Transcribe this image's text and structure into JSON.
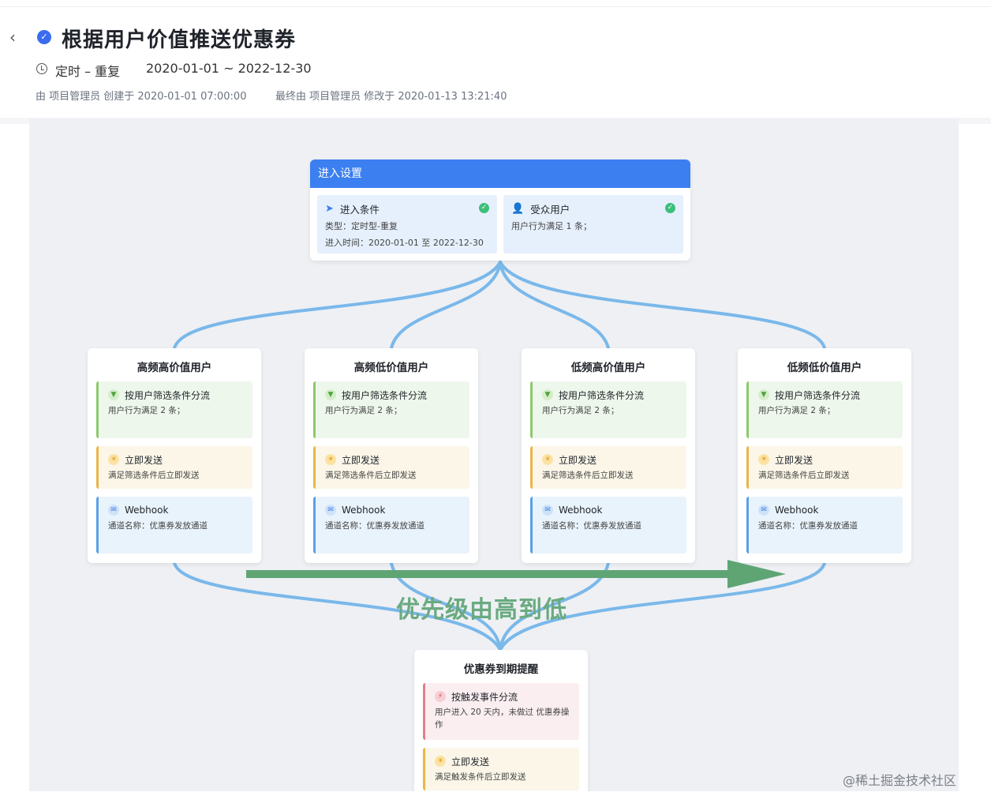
{
  "header": {
    "title": "根据用户价值推送优惠券",
    "schedule_type": "定时 – 重复",
    "schedule_range": "2020-01-01 ~ 2022-12-30",
    "created": "由 项目管理员 创建于 2020-01-01 07:00:00",
    "modified": "最终由 项目管理员 修改于 2020-01-13 13:21:40"
  },
  "entry": {
    "title": "进入设置",
    "condition": {
      "title": "进入条件",
      "type": "类型：定时型-重复",
      "time": "进入时间：2020-01-01 至 2022-12-30"
    },
    "audience": {
      "title": "受众用户",
      "desc": "用户行为满足 1 条；"
    }
  },
  "branches": [
    {
      "title": "高频高价值用户",
      "filter_title": "按用户筛选条件分流",
      "filter_desc": "用户行为满足 2 条；",
      "send_title": "立即发送",
      "send_desc": "满足筛选条件后立即发送",
      "hook_title": "Webhook",
      "hook_desc": "通道名称：优惠券发放通道"
    },
    {
      "title": "高频低价值用户",
      "filter_title": "按用户筛选条件分流",
      "filter_desc": "用户行为满足 2 条；",
      "send_title": "立即发送",
      "send_desc": "满足筛选条件后立即发送",
      "hook_title": "Webhook",
      "hook_desc": "通道名称：优惠券发放通道"
    },
    {
      "title": "低频高价值用户",
      "filter_title": "按用户筛选条件分流",
      "filter_desc": "用户行为满足 2 条；",
      "send_title": "立即发送",
      "send_desc": "满足筛选条件后立即发送",
      "hook_title": "Webhook",
      "hook_desc": "通道名称：优惠券发放通道"
    },
    {
      "title": "低频低价值用户",
      "filter_title": "按用户筛选条件分流",
      "filter_desc": "用户行为满足 2 条；",
      "send_title": "立即发送",
      "send_desc": "满足筛选条件后立即发送",
      "hook_title": "Webhook",
      "hook_desc": "通道名称：优惠券发放通道"
    }
  ],
  "final": {
    "title": "优惠券到期提醒",
    "trigger_title": "按触发事件分流",
    "trigger_desc": "用户进入 20 天内，未做过 优惠券操作",
    "send_title": "立即发送",
    "send_desc": "满足触发条件后立即发送"
  },
  "annotation": {
    "priority": "优先级由高到低"
  },
  "credit": "@稀土掘金技术社区",
  "colors": {
    "primary": "#3b7ff0",
    "connector": "#7ab8ea",
    "priority_arrow": "#5fa574",
    "filter_accent": "#8cc96d",
    "send_accent": "#eab54a",
    "hook_accent": "#5aa0e8",
    "trigger_accent": "#e37d8c"
  },
  "icons": [
    "back-icon",
    "status-icon",
    "clock-icon",
    "send-icon",
    "user-icon",
    "check-icon",
    "filter-icon",
    "sun-icon",
    "mail-icon",
    "bolt-icon"
  ]
}
